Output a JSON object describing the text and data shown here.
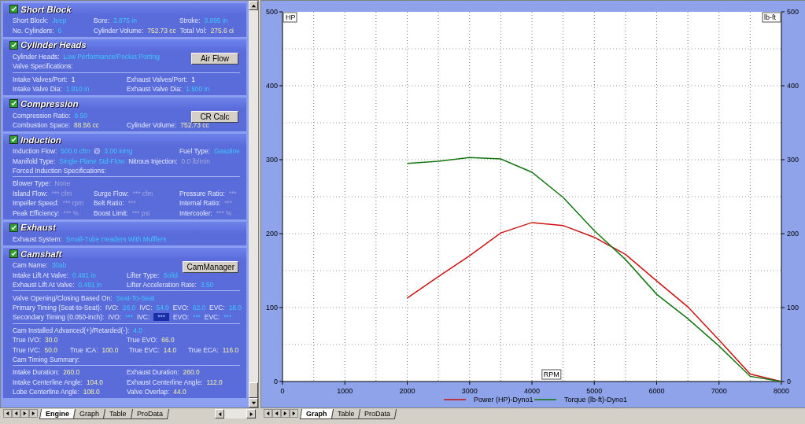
{
  "engine_panel": {
    "sections": [
      {
        "title": "Short Block",
        "checked": true,
        "rows": [
          {
            "cells": [
              {
                "label": "Short Block:",
                "value": "Jeep",
                "kind": "input"
              },
              {
                "label": "Bore:",
                "value": "3.875 in",
                "kind": "input"
              },
              {
                "label": "Stroke:",
                "value": "3.895 in",
                "kind": "input"
              }
            ]
          },
          {
            "cells": [
              {
                "label": "No. Cylinders:",
                "value": "6",
                "kind": "input"
              },
              {
                "label": "Cylinder Volume:",
                "value": "752.73 cc",
                "kind": "calc"
              },
              {
                "label": "Total Vol:",
                "value": "275.6 ci",
                "kind": "calc"
              }
            ]
          }
        ]
      },
      {
        "title": "Cylinder Heads",
        "checked": true,
        "button": "Air Flow",
        "rows": [
          {
            "cells": [
              {
                "label": "Cylinder Heads:",
                "value": "Low Performance/Pocket Porting",
                "kind": "input"
              }
            ]
          },
          {
            "cells": [
              {
                "label": "Valve Specifications:"
              }
            ],
            "divider_after": true
          },
          {
            "cells": [
              {
                "label": "Intake Valves/Port:",
                "value": "1",
                "kind": "plain"
              },
              {
                "label": "Exhaust Valves/Port:",
                "value": "1",
                "kind": "plain"
              }
            ]
          },
          {
            "cells": [
              {
                "label": "Intake Valve Dia:",
                "value": "1.910 in",
                "kind": "input"
              },
              {
                "label": "Exhaust Valve Dia:",
                "value": "1.500 in",
                "kind": "input"
              }
            ]
          }
        ]
      },
      {
        "title": "Compression",
        "checked": true,
        "button": "CR Calc",
        "rows": [
          {
            "cells": [
              {
                "label": "Compression Ratio:",
                "value": "9.50",
                "kind": "input"
              }
            ]
          },
          {
            "cells": [
              {
                "label": "Combustion Space:",
                "value": "88.56 cc",
                "kind": "calc"
              },
              {
                "label": "Cylinder Volume:",
                "value": "752.73 cc",
                "kind": "calc"
              }
            ]
          }
        ]
      },
      {
        "title": "Induction",
        "checked": true,
        "rows": [
          {
            "cells": [
              {
                "label": "Induction Flow:",
                "value": "500.0 cfm",
                "kind": "input"
              },
              {
                "label": "@",
                "value": "3.00 inHg",
                "kind": "input"
              },
              {
                "label": "Fuel Type:",
                "value": "Gasoline",
                "kind": "input"
              }
            ]
          },
          {
            "cells": [
              {
                "label": "Manifold Type:",
                "value": "Single-Plane Std-Flow",
                "kind": "input"
              },
              {
                "label": "Nitrous Injection:",
                "value": "0.0 lb/min",
                "kind": "off"
              }
            ]
          },
          {
            "cells": [
              {
                "label": "Forced Induction Specifications:"
              }
            ],
            "divider_after": true
          },
          {
            "cells": [
              {
                "label": "Blower Type:",
                "value": "None",
                "kind": "off"
              }
            ]
          },
          {
            "cells": [
              {
                "label": "Island Flow:",
                "value": "*** cfm",
                "kind": "off"
              },
              {
                "label": "Surge Flow:",
                "value": "*** cfm",
                "kind": "off"
              },
              {
                "label": "Pressure Ratio:",
                "value": "***",
                "kind": "off"
              }
            ]
          },
          {
            "cells": [
              {
                "label": "Impeller Speed:",
                "value": "*** rpm",
                "kind": "off"
              },
              {
                "label": "Belt Ratio:",
                "value": "***",
                "kind": "off"
              },
              {
                "label": "Internal Ratio:",
                "value": "***",
                "kind": "off"
              }
            ]
          },
          {
            "cells": [
              {
                "label": "Peak Efficiency:",
                "value": "*** %",
                "kind": "off"
              },
              {
                "label": "Boost Limit:",
                "value": "*** psi",
                "kind": "off"
              },
              {
                "label": "Intercooler:",
                "value": "*** %",
                "kind": "off"
              }
            ]
          }
        ]
      },
      {
        "title": "Exhaust",
        "checked": true,
        "rows": [
          {
            "cells": [
              {
                "label": "Exhaust System:",
                "value": "Small-Tube Headers With Mufflers",
                "kind": "input"
              }
            ]
          }
        ]
      },
      {
        "title": "Camshaft",
        "checked": true,
        "button": "CamManager",
        "rows": [
          {
            "cells": [
              {
                "label": "Cam Name:",
                "value": "30ab",
                "kind": "input"
              }
            ]
          },
          {
            "cells": [
              {
                "label": "Intake Lift At Valve:",
                "value": "0.481 in",
                "kind": "input"
              },
              {
                "label": "Lifter Type:",
                "value": "Solid",
                "kind": "input"
              }
            ]
          },
          {
            "cells": [
              {
                "label": "Exhaust Lift At Valve:",
                "value": "0.481 in",
                "kind": "input"
              },
              {
                "label": "Lifter Acceleration Rate:",
                "value": "3.50",
                "kind": "input"
              }
            ],
            "divider_after": true
          },
          {
            "cells": [
              {
                "label": "Valve Opening/Closing Based On:",
                "value": "Seat-To-Seat",
                "kind": "input"
              }
            ]
          },
          {
            "cells": [
              {
                "label": "Primary Timing  (Seat-to-Seat):"
              },
              {
                "label": "IVO:",
                "value": "26.0",
                "kind": "input"
              },
              {
                "label": "IVC:",
                "value": "54.0",
                "kind": "input"
              },
              {
                "label": "EVO:",
                "value": "62.0",
                "kind": "input"
              },
              {
                "label": "EVC:",
                "value": "18.0",
                "kind": "input"
              }
            ]
          },
          {
            "cells": [
              {
                "label": "Secondary Timing (0.050-inch):"
              },
              {
                "label": "IVO:",
                "value": "***",
                "kind": "input"
              },
              {
                "label": "IVC:",
                "value": "***",
                "kind": "focus"
              },
              {
                "label": "EVO:",
                "value": "***",
                "kind": "input"
              },
              {
                "label": "EVC:",
                "value": "***",
                "kind": "input"
              }
            ],
            "divider_after": true
          },
          {
            "cells": [
              {
                "label": "Cam Installed Advanced(+)/Retarded(-):",
                "value": "4.0",
                "kind": "input"
              }
            ]
          },
          {
            "cells": [
              {
                "label": "True IVO:",
                "value": "30.0",
                "kind": "calc"
              },
              {
                "label": "True EVO:",
                "value": "66.0",
                "kind": "calc"
              }
            ]
          },
          {
            "cells": [
              {
                "label": "True IVC:",
                "value": "50.0",
                "kind": "calc"
              },
              {
                "label": "True ICA:",
                "value": "100.0",
                "kind": "calc"
              },
              {
                "label": "True EVC:",
                "value": "14.0",
                "kind": "calc"
              },
              {
                "label": "True ECA:",
                "value": "116.0",
                "kind": "calc"
              }
            ]
          },
          {
            "cells": [
              {
                "label": "Cam Timing Summary:"
              }
            ],
            "divider_after": true
          },
          {
            "cells": [
              {
                "label": "Intake Duration:",
                "value": "260.0",
                "kind": "calc"
              },
              {
                "label": "Exhaust Duration:",
                "value": "260.0",
                "kind": "calc"
              }
            ]
          },
          {
            "cells": [
              {
                "label": "Intake Centerline Angle:",
                "value": "104.0",
                "kind": "calc"
              },
              {
                "label": "Exhaust Centerline Angle:",
                "value": "112.0",
                "kind": "calc"
              }
            ]
          },
          {
            "cells": [
              {
                "label": "Lobe Centerline Angle:",
                "value": "108.0",
                "kind": "calc"
              },
              {
                "label": "Valve Overlap:",
                "value": "44.0",
                "kind": "calc"
              }
            ]
          }
        ]
      }
    ],
    "tabs": [
      {
        "label": "Engine",
        "selected": true
      },
      {
        "label": "Graph",
        "selected": false
      },
      {
        "label": "Table",
        "selected": false
      },
      {
        "label": "ProData",
        "selected": false
      }
    ]
  },
  "graph_panel": {
    "right_axis_label": "lb-ft",
    "right_axis_ticks": [
      "500",
      "400",
      "300",
      "200",
      "100",
      "0"
    ],
    "chart_data": {
      "type": "line",
      "xlabel": "RPM",
      "ylabel": "HP",
      "grid": true,
      "legend": "bottom",
      "x": [
        2000,
        2500,
        3000,
        3500,
        4000,
        4500,
        5000,
        5500,
        6000,
        6500,
        7000,
        7500,
        8000
      ],
      "xlim": [
        0,
        8000
      ],
      "ylim": [
        0,
        500
      ],
      "xticks": [
        0,
        1000,
        2000,
        3000,
        4000,
        5000,
        6000,
        7000,
        8000
      ],
      "yticks": [
        0,
        100,
        200,
        300,
        400,
        500
      ],
      "series": [
        {
          "name": "Power (HP)-Dyno1",
          "color": "#cc1111",
          "values": [
            113,
            142,
            170,
            201,
            215,
            211,
            195,
            172,
            136,
            101,
            56,
            10,
            0
          ]
        },
        {
          "name": "Torque (lb-ft)-Dyno1",
          "color": "#117711",
          "values": [
            295,
            298,
            303,
            301,
            283,
            249,
            204,
            165,
            118,
            85,
            48,
            7,
            0
          ]
        }
      ]
    },
    "tabs": [
      {
        "label": "Graph",
        "selected": true
      },
      {
        "label": "Table",
        "selected": false
      },
      {
        "label": "ProData",
        "selected": false
      }
    ]
  }
}
